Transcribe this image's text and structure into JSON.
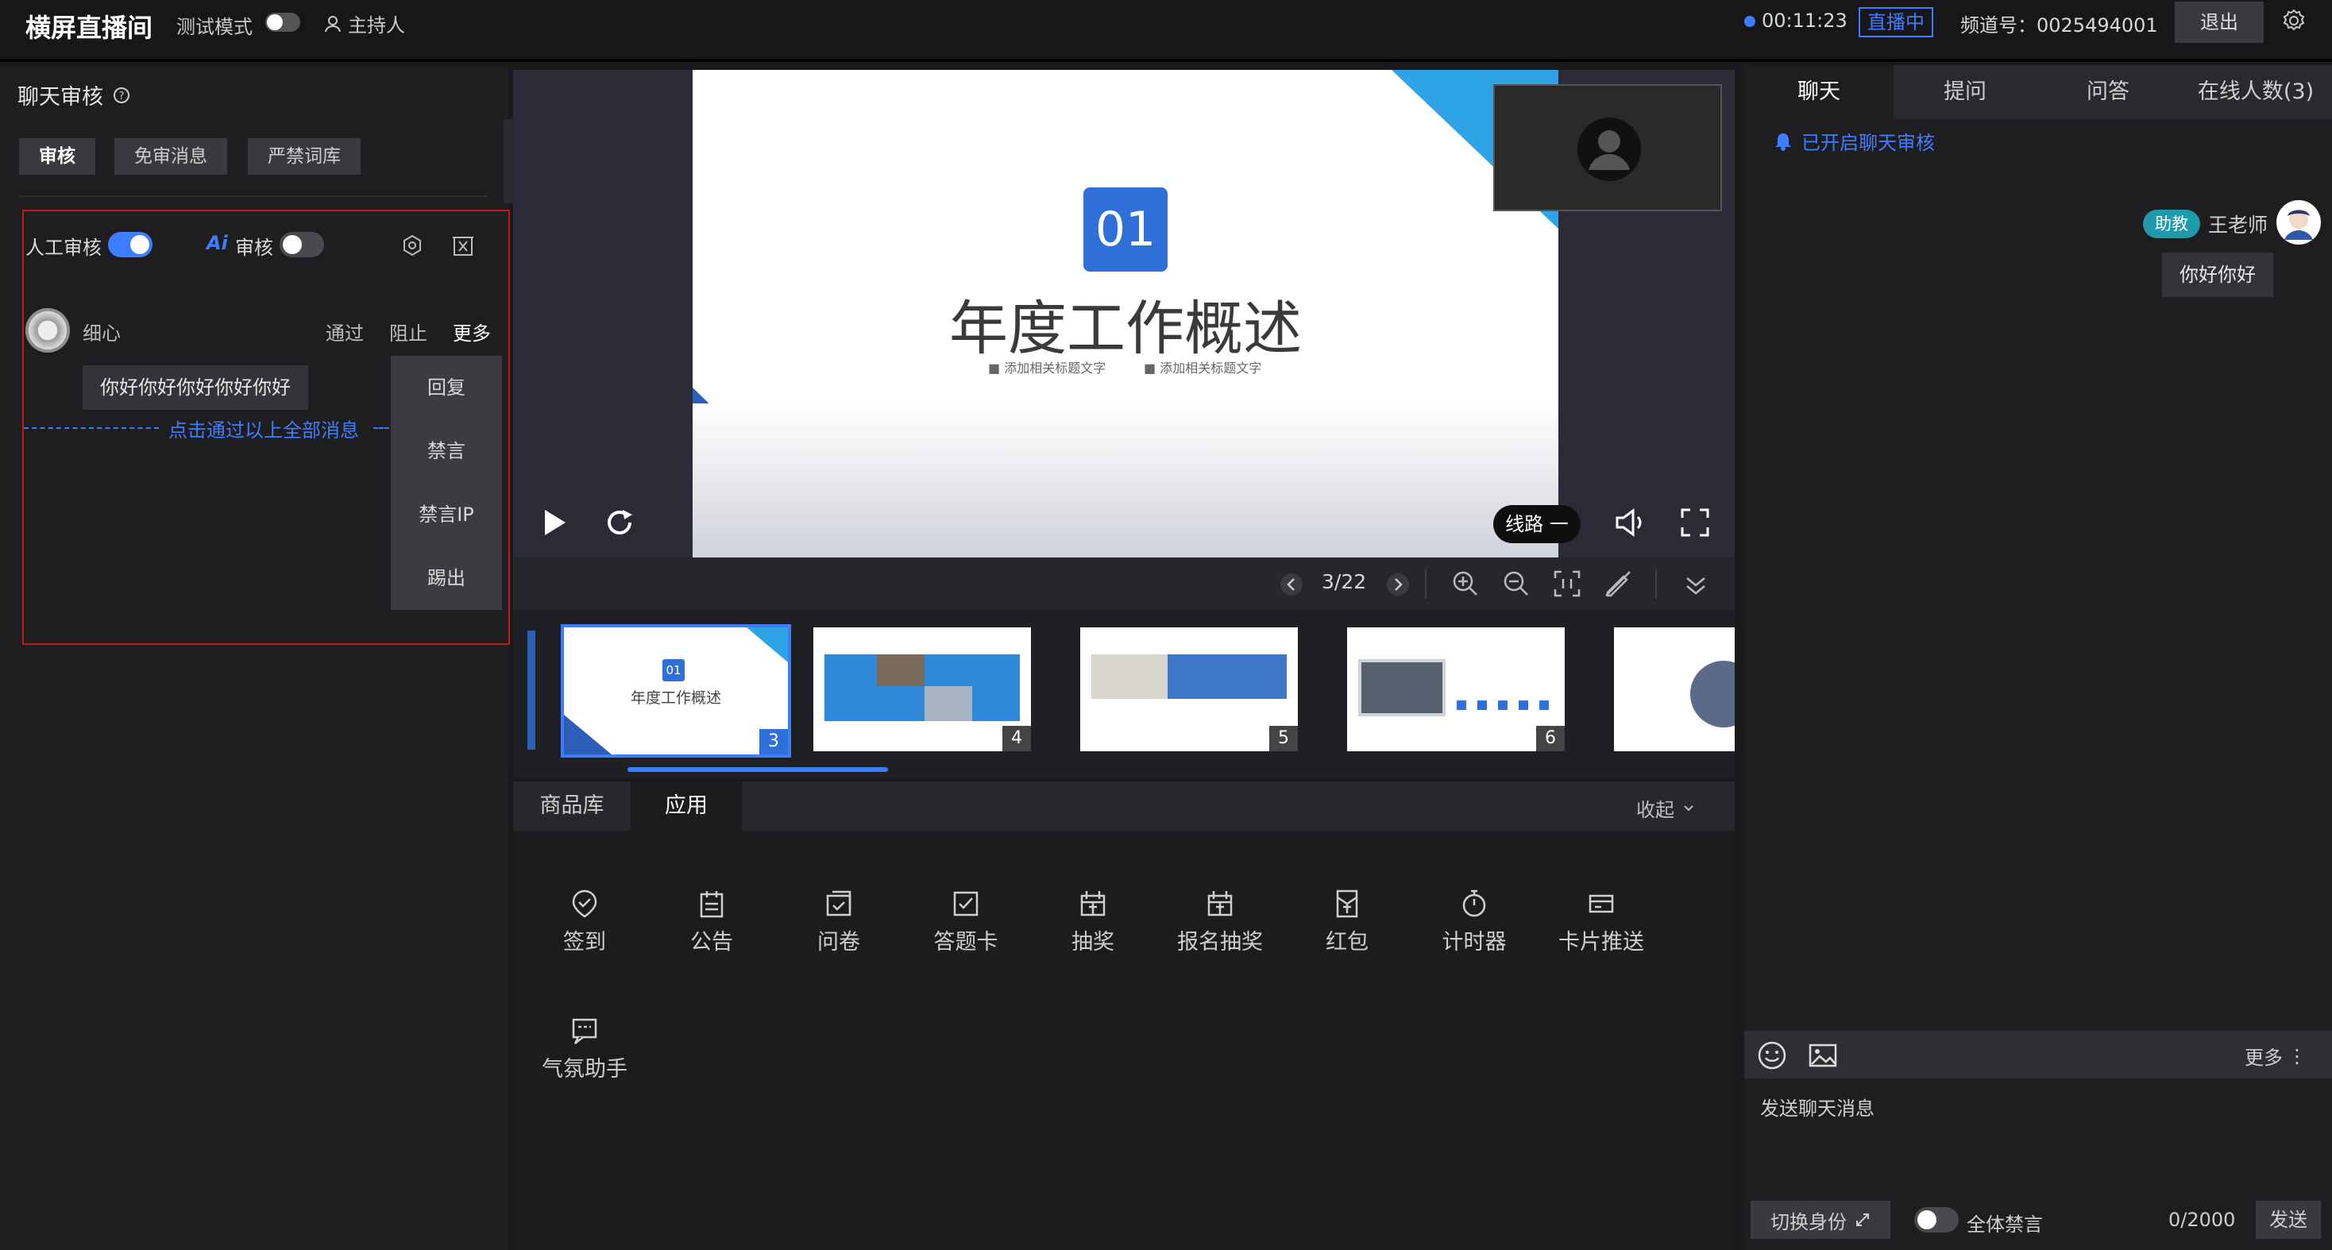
{
  "topbar": {
    "title": "横屏直播间",
    "test_mode": "测试模式",
    "host": "主持人",
    "timer": "00:11:23",
    "live_badge": "直播中",
    "channel": "频道号：0025494001",
    "exit": "退出"
  },
  "left": {
    "title": "聊天审核",
    "tabs": [
      "审核",
      "免审消息",
      "严禁词库"
    ],
    "manual_review": "人工审核",
    "ai_label": "Ai",
    "ai_review": "审核",
    "user": "细心",
    "approve": "通过",
    "block": "阻止",
    "more": "更多",
    "message": "你好你好你好你好你好",
    "approve_all": "点击通过以上全部消息",
    "menu": [
      "回复",
      "禁言",
      "禁言IP",
      "踢出"
    ]
  },
  "slide": {
    "number": "01",
    "title": "年度工作概述",
    "sub_left": "■ 添加相关标题文字",
    "sub_right": "■ 添加相关标题文字"
  },
  "player": {
    "route": "线路 一",
    "page": "3/22"
  },
  "thumbs": [
    {
      "num": "3",
      "title": "年度工作概述",
      "tag": "01"
    },
    {
      "num": "4"
    },
    {
      "num": "5"
    },
    {
      "num": "6"
    },
    {
      "num": ""
    }
  ],
  "bottom": {
    "tabs": [
      "商品库",
      "应用"
    ],
    "collapse": "收起"
  },
  "apps": [
    "签到",
    "公告",
    "问卷",
    "答题卡",
    "抽奖",
    "报名抽奖",
    "红包",
    "计时器",
    "卡片推送",
    "气氛助手"
  ],
  "right": {
    "tabs": [
      "聊天",
      "提问",
      "问答",
      "在线人数(3)"
    ],
    "notice": "已开启聊天审核",
    "role_badge": "助教",
    "sender": "王老师",
    "chat_message": "你好你好",
    "more": "更多",
    "placeholder": "发送聊天消息",
    "switch_identity": "切换身份",
    "mute_all": "全体禁言",
    "counter": "0/2000",
    "send": "发送"
  },
  "colors": {
    "accent": "#3d7dff",
    "warning_border": "#c21a1a",
    "slide_blue": "#2e6fd8"
  }
}
